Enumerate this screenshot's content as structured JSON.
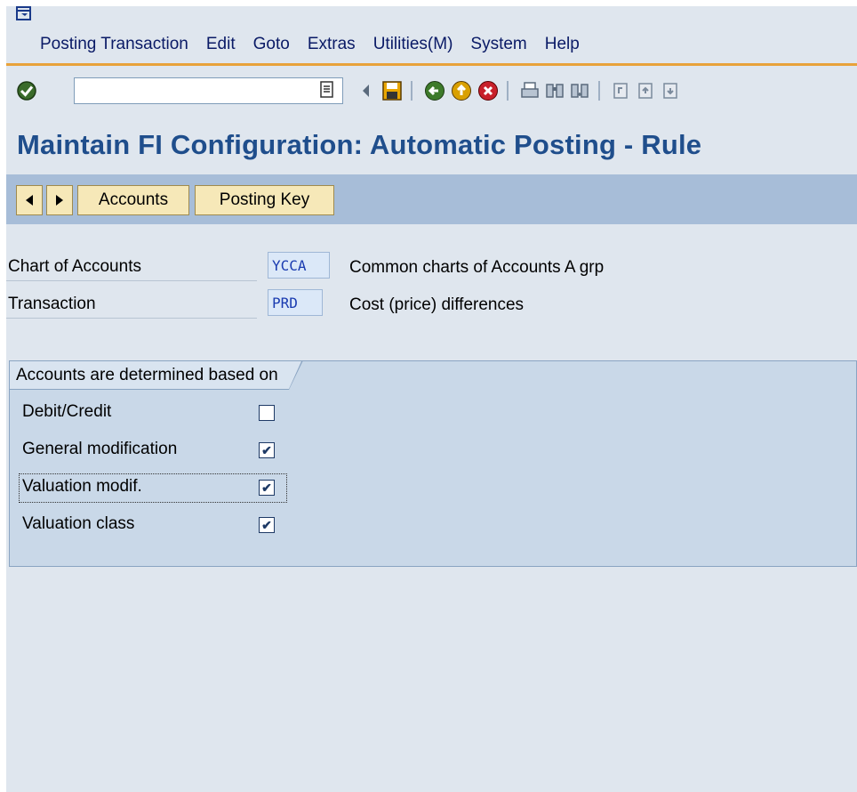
{
  "menu": {
    "items": [
      "Posting Transaction",
      "Edit",
      "Goto",
      "Extras",
      "Utilities(M)",
      "System",
      "Help"
    ]
  },
  "toolbar": {
    "command_value": "",
    "icons": [
      "enter-icon",
      "command-dropdown-icon",
      "collapse-icon",
      "save-icon",
      "back-icon",
      "exit-icon",
      "cancel-icon",
      "print-icon",
      "find-icon",
      "find-next-icon",
      "first-page-icon",
      "previous-page-icon",
      "next-page-icon"
    ]
  },
  "title": "Maintain FI Configuration: Automatic Posting - Rule",
  "app_toolbar": {
    "accounts_label": "Accounts",
    "posting_key_label": "Posting Key"
  },
  "fields": {
    "chart_of_accounts": {
      "label": "Chart of Accounts",
      "value": "YCCA",
      "description": "Common charts of Accounts A grp"
    },
    "transaction": {
      "label": "Transaction",
      "value": "PRD",
      "description": "Cost (price) differences"
    }
  },
  "group": {
    "title": "Accounts are determined based on",
    "options": [
      {
        "label": "Debit/Credit",
        "checked": false
      },
      {
        "label": "General modification",
        "checked": true
      },
      {
        "label": "Valuation modif.",
        "checked": true
      },
      {
        "label": "Valuation class",
        "checked": true
      }
    ]
  },
  "colors": {
    "accent": "#e8a23a",
    "title": "#1f4e8c",
    "app_toolbar": "#a7bdd8",
    "button": "#f6e8b8"
  }
}
